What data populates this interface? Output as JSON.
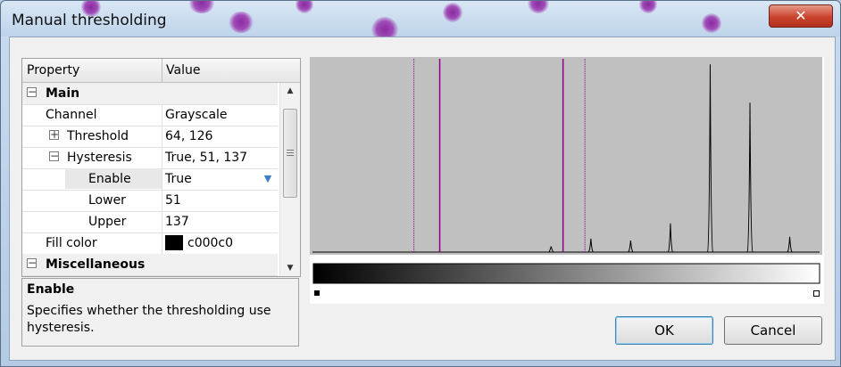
{
  "window": {
    "title": "Manual thresholding",
    "close_glyph": "✕"
  },
  "property_grid": {
    "header": {
      "property": "Property",
      "value": "Value"
    },
    "rows": [
      {
        "kind": "category",
        "toggle": "−",
        "name": "Main",
        "value": ""
      },
      {
        "kind": "prop",
        "toggle": "",
        "name": "Channel",
        "value": "Grayscale"
      },
      {
        "kind": "prop",
        "toggle": "+",
        "name": "Threshold",
        "value": "64, 126"
      },
      {
        "kind": "prop",
        "toggle": "−",
        "name": "Hysteresis",
        "value": "True, 51, 137"
      },
      {
        "kind": "prop-selected",
        "toggle": "",
        "name": "Enable",
        "value": "True"
      },
      {
        "kind": "prop",
        "toggle": "",
        "name": "Lower",
        "value": "51"
      },
      {
        "kind": "prop",
        "toggle": "",
        "name": "Upper",
        "value": "137"
      },
      {
        "kind": "prop-color",
        "toggle": "",
        "name": "Fill color",
        "value": "c000c0",
        "swatch": "#000000"
      },
      {
        "kind": "category",
        "toggle": "−",
        "name": "Miscellaneous",
        "value": ""
      }
    ],
    "dropdown_icon": "chevron-down-icon",
    "scroll_up_glyph": "▲",
    "scroll_down_glyph": "▼"
  },
  "description": {
    "title": "Enable",
    "text": "Specifies whether the thresholding use hysteresis."
  },
  "histogram": {
    "background": "#c0c0c0",
    "solid_markers": [
      64,
      126
    ],
    "dotted_markers": [
      51,
      137
    ],
    "marker_color": "#8b008b",
    "peaks": [
      {
        "pos": 120,
        "h": 0.03
      },
      {
        "pos": 140,
        "h": 0.07
      },
      {
        "pos": 160,
        "h": 0.06
      },
      {
        "pos": 180,
        "h": 0.15
      },
      {
        "pos": 200,
        "h": 0.98
      },
      {
        "pos": 220,
        "h": 0.78
      },
      {
        "pos": 240,
        "h": 0.08
      }
    ]
  },
  "buttons": {
    "ok": "OK",
    "cancel": "Cancel"
  }
}
